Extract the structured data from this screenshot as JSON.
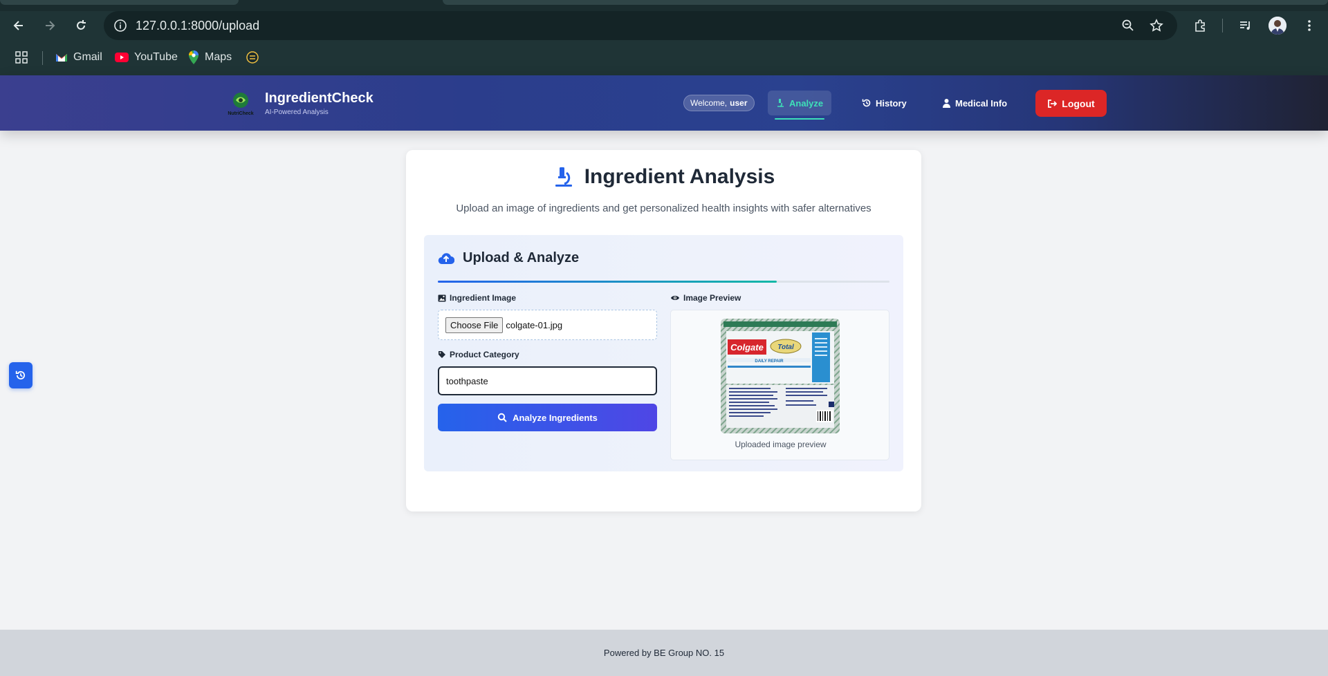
{
  "browser": {
    "url": "127.0.0.1:8000/upload",
    "bookmarks": [
      {
        "label": "Gmail",
        "icon": "gmail-icon"
      },
      {
        "label": "YouTube",
        "icon": "youtube-icon"
      },
      {
        "label": "Maps",
        "icon": "maps-icon"
      },
      {
        "label": "",
        "icon": "extension-bookmark-icon"
      }
    ]
  },
  "navbar": {
    "brand_name": "IngredientCheck",
    "brand_subtitle": "AI-Powered Analysis",
    "logo_text": "NutriCheck",
    "welcome_prefix": "Welcome,",
    "welcome_user": "user",
    "links": [
      {
        "label": "Analyze",
        "icon": "microscope-icon",
        "active": true
      },
      {
        "label": "History",
        "icon": "history-icon",
        "active": false
      },
      {
        "label": "Medical Info",
        "icon": "user-medical-icon",
        "active": false
      }
    ],
    "logout_label": "Logout"
  },
  "main": {
    "title": "Ingredient Analysis",
    "subtitle": "Upload an image of ingredients and get personalized health insights with safer alternatives",
    "panel_title": "Upload & Analyze",
    "progress": 0.75,
    "image_label": "Ingredient Image",
    "choose_file_label": "Choose File",
    "file_name": "colgate-01.jpg",
    "category_label": "Product Category",
    "category_value": "toothpaste",
    "analyze_label": "Analyze Ingredients",
    "preview_label": "Image Preview",
    "preview_caption": "Uploaded image preview",
    "preview_brand": "Colgate",
    "preview_product": "Total",
    "preview_variant": "DAILY REPAIR"
  },
  "footer": {
    "text": "Powered by BE Group NO. 15"
  },
  "colors": {
    "accent": "#2563eb",
    "active_nav": "#3ee0b8",
    "logout": "#dc2626"
  }
}
